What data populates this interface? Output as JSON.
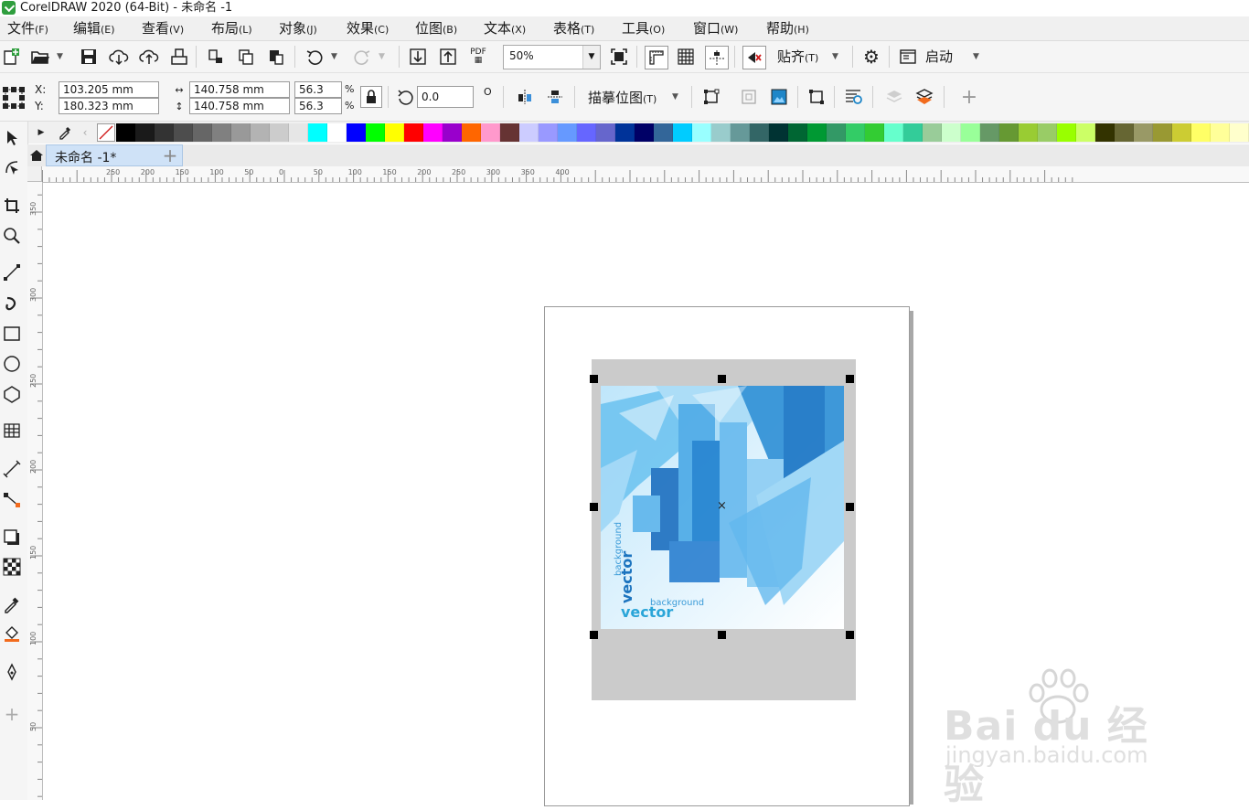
{
  "window": {
    "title": "CorelDRAW 2020 (64-Bit) - 未命名 -1"
  },
  "menu": [
    {
      "label": "文件",
      "key": "(F)"
    },
    {
      "label": "编辑",
      "key": "(E)"
    },
    {
      "label": "查看",
      "key": "(V)"
    },
    {
      "label": "布局",
      "key": "(L)"
    },
    {
      "label": "对象",
      "key": "(J)"
    },
    {
      "label": "效果",
      "key": "(C)"
    },
    {
      "label": "位图",
      "key": "(B)"
    },
    {
      "label": "文本",
      "key": "(X)"
    },
    {
      "label": "表格",
      "key": "(T)"
    },
    {
      "label": "工具",
      "key": "(O)"
    },
    {
      "label": "窗口",
      "key": "(W)"
    },
    {
      "label": "帮助",
      "key": "(H)"
    }
  ],
  "toolbar": {
    "pdf_label": "PDF",
    "zoom": "50%",
    "snap_label": "贴齐",
    "snap_key": "(T)",
    "launch_label": "启动"
  },
  "propbar": {
    "x_label": "X:",
    "y_label": "Y:",
    "x": "103.205 mm",
    "y": "180.323 mm",
    "width": "140.758 mm",
    "height": "140.758 mm",
    "scale_x": "56.3",
    "scale_y": "56.3",
    "percent": "%",
    "rotation": "0.0",
    "degree": "O",
    "trace_label": "描摹位图",
    "trace_key": "(T)"
  },
  "document": {
    "tab_label": "未命名 -1*"
  },
  "palette": [
    "#000000",
    "#1a1a1a",
    "#333333",
    "#4d4d4d",
    "#666666",
    "#808080",
    "#999999",
    "#b3b3b3",
    "#cccccc",
    "#e6e6e6",
    "#00ffff",
    "#ffffff",
    "#0000ff",
    "#00ff00",
    "#ffff00",
    "#ff0000",
    "#ff00ff",
    "#9900cc",
    "#ff6600",
    "#ff99cc",
    "#663333",
    "#ccccff",
    "#9999ff",
    "#6699ff",
    "#6666ff",
    "#6666cc",
    "#003399",
    "#000066",
    "#336699",
    "#00ccff",
    "#99ffff",
    "#99cccc",
    "#669999",
    "#336666",
    "#003333",
    "#006633",
    "#009933",
    "#339966",
    "#33cc66",
    "#33cc33",
    "#66ffcc",
    "#33cc99",
    "#99cc99",
    "#ccffcc",
    "#99ff99",
    "#669966",
    "#669933",
    "#99cc33",
    "#99cc66",
    "#99ff00",
    "#ccff66",
    "#333300",
    "#666633",
    "#999966",
    "#999933",
    "#cccc33",
    "#ffff66",
    "#ffff99",
    "#ffffcc"
  ],
  "ruler": {
    "h": [
      "250",
      "200",
      "150",
      "100",
      "50",
      "0",
      "50",
      "100",
      "150",
      "200",
      "250",
      "300",
      "350",
      "400"
    ],
    "v": [
      "350",
      "300",
      "250",
      "200",
      "150",
      "100",
      "50"
    ]
  },
  "image_content": {
    "word_small": "background",
    "word_big": "vector"
  },
  "watermark": {
    "logo": "Bai du 经验",
    "url": "jingyan.baidu.com"
  }
}
